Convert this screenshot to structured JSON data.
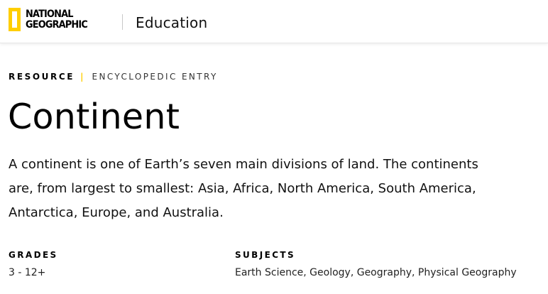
{
  "header": {
    "logo_line1": "NATIONAL",
    "logo_line2": "GEOGRAPHIC",
    "section": "Education",
    "accent_color": "#ffce00"
  },
  "eyebrow": {
    "type": "RESOURCE",
    "separator": "|",
    "kind": "ENCYCLOPEDIC ENTRY"
  },
  "article": {
    "title": "Continent",
    "description": "A continent is one of Earth’s seven main divisions of land. The continents are, from largest to smallest: Asia, Africa, North America, South America, Antarctica, Europe, and Australia."
  },
  "meta": {
    "grades_label": "GRADES",
    "grades_value": "3 - 12+",
    "subjects_label": "SUBJECTS",
    "subjects_value": "Earth Science, Geology, Geography, Physical Geography"
  }
}
